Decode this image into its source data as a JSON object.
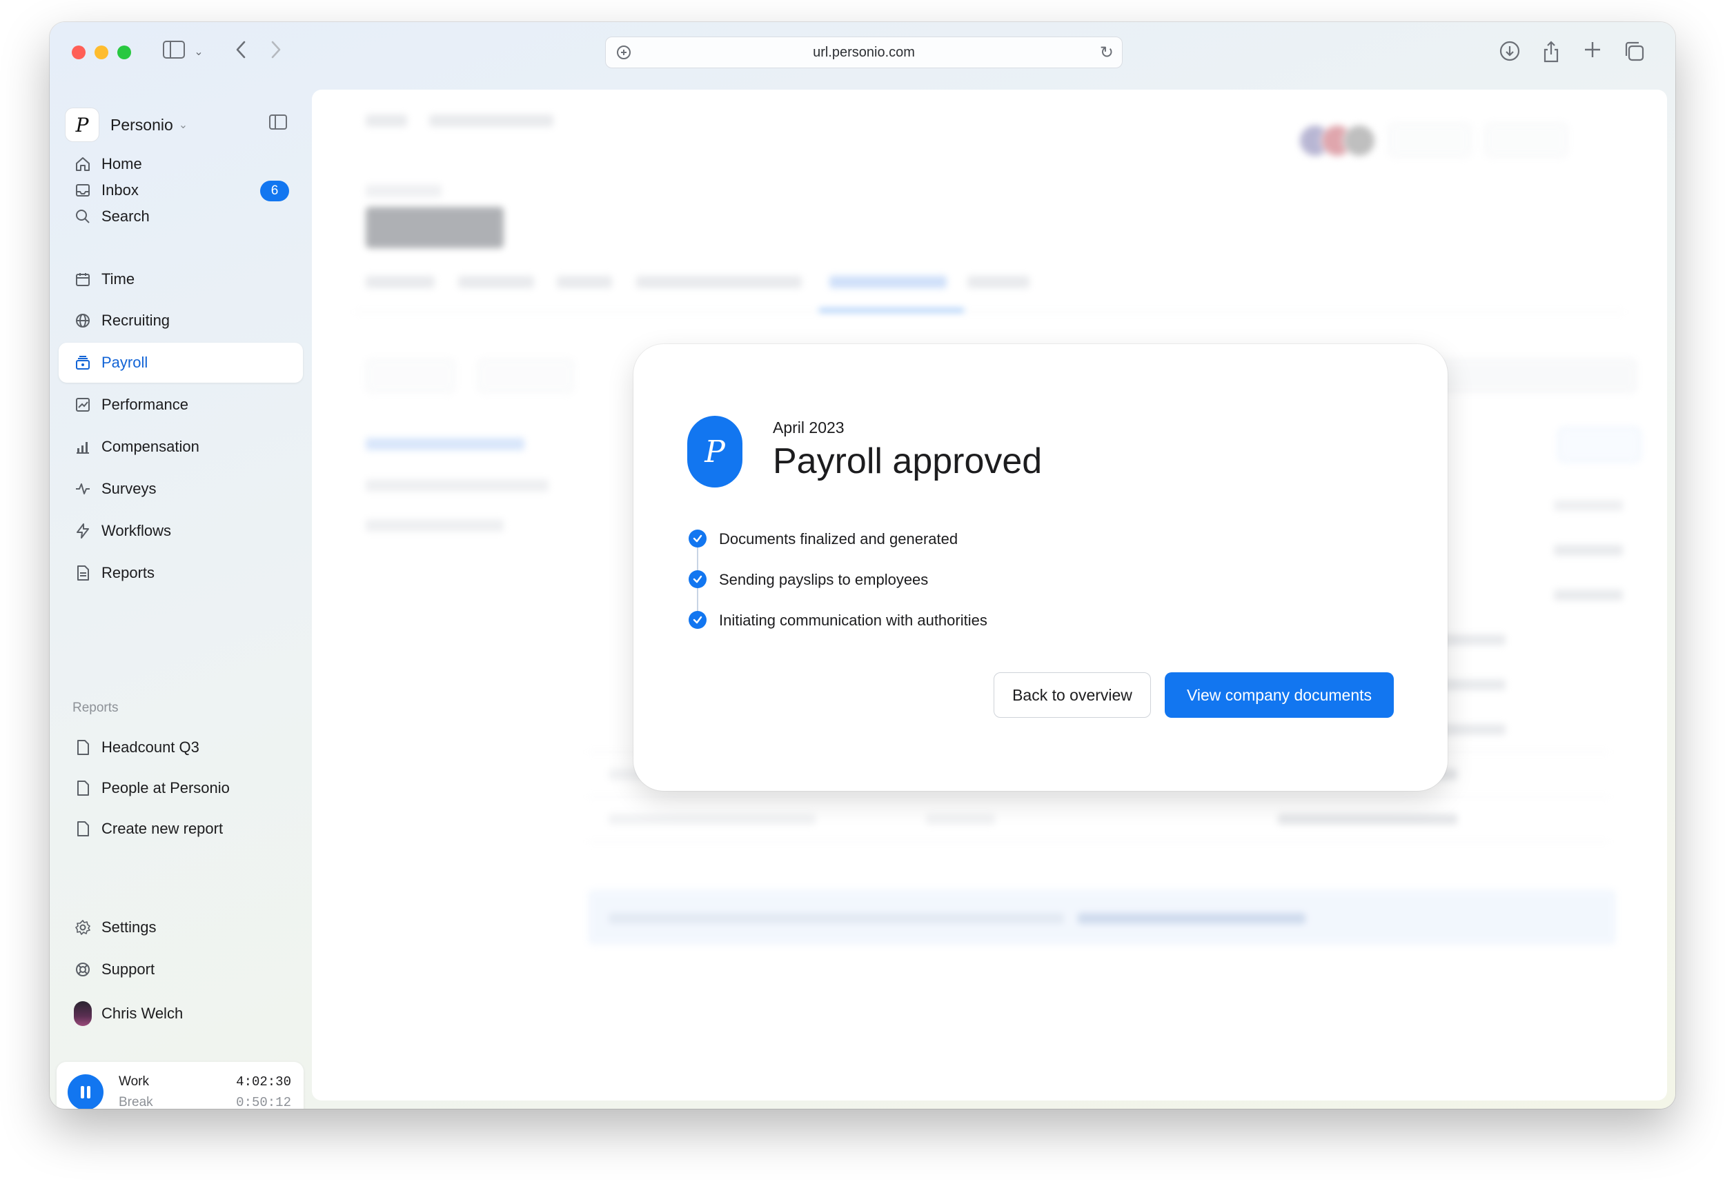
{
  "browser": {
    "url": "url.personio.com"
  },
  "sidebar": {
    "brand_name": "Personio",
    "nav_items": [
      {
        "label": "Home",
        "icon": "home-icon"
      },
      {
        "label": "Inbox",
        "icon": "inbox-icon",
        "badge": "6"
      },
      {
        "label": "Search",
        "icon": "search-icon"
      },
      {
        "label": "Time",
        "icon": "calendar-icon"
      },
      {
        "label": "Recruiting",
        "icon": "globe-icon"
      },
      {
        "label": "Payroll",
        "icon": "payroll-icon",
        "active": true
      },
      {
        "label": "Performance",
        "icon": "chart-up-icon"
      },
      {
        "label": "Compensation",
        "icon": "bar-chart-icon"
      },
      {
        "label": "Surveys",
        "icon": "pulse-icon"
      },
      {
        "label": "Workflows",
        "icon": "bolt-icon"
      },
      {
        "label": "Reports",
        "icon": "document-icon"
      }
    ],
    "reports_section_label": "Reports",
    "reports_items": [
      {
        "label": "Headcount Q3",
        "icon": "file-icon"
      },
      {
        "label": "People at Personio",
        "icon": "file-icon"
      },
      {
        "label": "Create new report",
        "icon": "file-icon"
      }
    ],
    "bottom_items": [
      {
        "label": "Settings",
        "icon": "gear-icon"
      },
      {
        "label": "Support",
        "icon": "lifebuoy-icon"
      },
      {
        "label": "Chris Welch",
        "icon": "avatar"
      }
    ],
    "timer": {
      "work_label": "Work",
      "work_time": "4:02:30",
      "break_label": "Break",
      "break_time": "0:50:12"
    }
  },
  "modal": {
    "subtitle": "April 2023",
    "title": "Payroll approved",
    "steps": [
      "Documents finalized and generated",
      "Sending payslips to employees",
      "Initiating communication with authorities"
    ],
    "back_button": "Back to overview",
    "primary_button": "View company documents"
  },
  "colors": {
    "accent": "#1276f0",
    "active_nav_text": "#1264d6"
  }
}
